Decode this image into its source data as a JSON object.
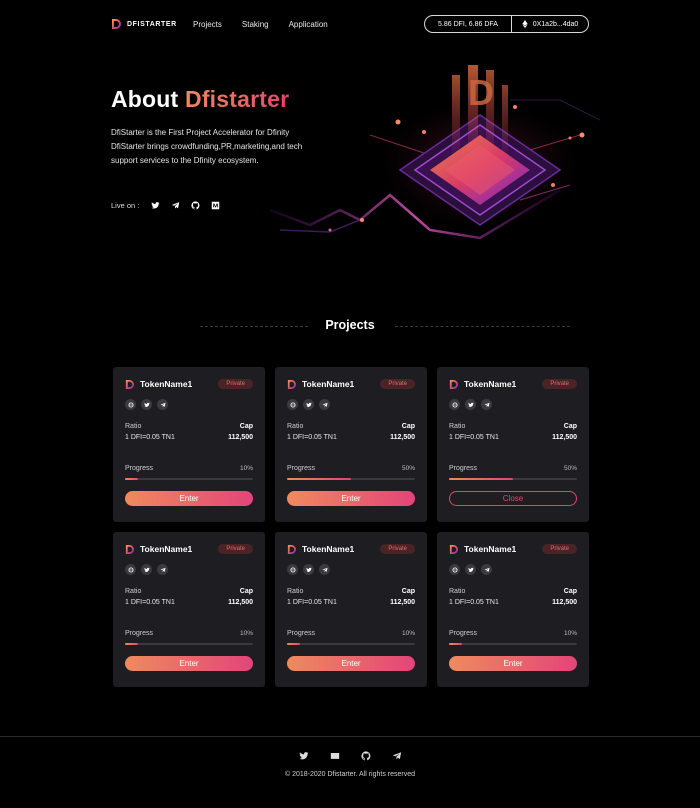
{
  "brand": {
    "name": "DFISTARTER"
  },
  "nav": {
    "links": [
      "Projects",
      "Staking",
      "Application"
    ]
  },
  "wallet": {
    "balance": "5.86 DFI, 6.86 DFA",
    "address": "0X1a2b...4da0"
  },
  "hero": {
    "title_prefix": "About ",
    "title_accent": "Dfistarter",
    "description": "DfiStarter is the First Project Accelerator for Dfinity DfiStarter brings crowdfunding,PR,marketing,and tech support services to the Dfinity ecosystem.",
    "live_label": "Live on :",
    "live_icons": [
      "twitter-icon",
      "telegram-icon",
      "github-icon",
      "medium-icon"
    ],
    "art_letter": "D"
  },
  "projects_section": {
    "title": "Projects"
  },
  "projects": [
    {
      "name": "TokenName1",
      "badge": "Private",
      "ratio_label": "Ratio",
      "ratio": "1 DFI=0.05 TN1",
      "cap_label": "Cap",
      "cap": "112,500",
      "progress_label": "Progress",
      "progress": "10%",
      "progress_value": 0.1,
      "button": "Enter",
      "button_style": "filled"
    },
    {
      "name": "TokenName1",
      "badge": "Private",
      "ratio_label": "Ratio",
      "ratio": "1 DFI=0.05 TN1",
      "cap_label": "Cap",
      "cap": "112,500",
      "progress_label": "Progress",
      "progress": "50%",
      "progress_value": 0.5,
      "button": "Enter",
      "button_style": "filled"
    },
    {
      "name": "TokenName1",
      "badge": "Private",
      "ratio_label": "Ratio",
      "ratio": "1 DFI=0.05 TN1",
      "cap_label": "Cap",
      "cap": "112,500",
      "progress_label": "Progress",
      "progress": "50%",
      "progress_value": 0.5,
      "button": "Close",
      "button_style": "outline"
    },
    {
      "name": "TokenName1",
      "badge": "Private",
      "ratio_label": "Ratio",
      "ratio": "1 DFI=0.05 TN1",
      "cap_label": "Cap",
      "cap": "112,500",
      "progress_label": "Progress",
      "progress": "10%",
      "progress_value": 0.1,
      "button": "Enter",
      "button_style": "filled"
    },
    {
      "name": "TokenName1",
      "badge": "Private",
      "ratio_label": "Ratio",
      "ratio": "1 DFI=0.05 TN1",
      "cap_label": "Cap",
      "cap": "112,500",
      "progress_label": "Progress",
      "progress": "10%",
      "progress_value": 0.1,
      "button": "Enter",
      "button_style": "filled"
    },
    {
      "name": "TokenName1",
      "badge": "Private",
      "ratio_label": "Ratio",
      "ratio": "1 DFI=0.05 TN1",
      "cap_label": "Cap",
      "cap": "112,500",
      "progress_label": "Progress",
      "progress": "10%",
      "progress_value": 0.1,
      "button": "Enter",
      "button_style": "filled"
    }
  ],
  "project_socials": [
    "website-icon",
    "twitter-icon",
    "telegram-icon"
  ],
  "footer": {
    "icons": [
      "twitter-icon",
      "mail-icon",
      "github-icon",
      "telegram-icon"
    ],
    "copyright": "© 2018-2020 Dfistarter. All rights reserved"
  },
  "colors": {
    "accent_start": "#f08a5d",
    "accent_end": "#e2456c",
    "card_bg": "#1e1e22",
    "badge_bg": "#4a2326",
    "badge_text": "#e26b6b"
  }
}
